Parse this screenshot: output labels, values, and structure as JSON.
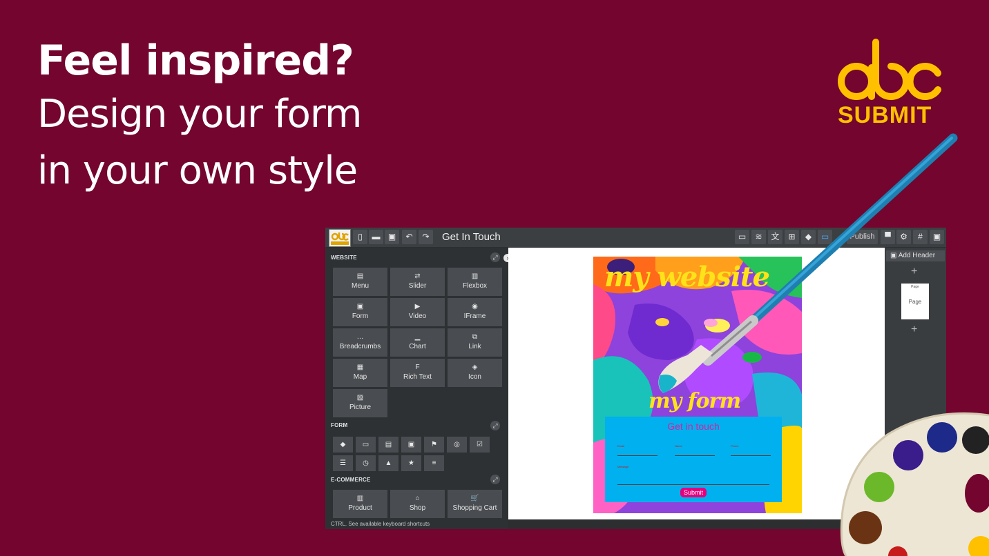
{
  "headline": {
    "line1": "Feel inspired?",
    "line2": "Design your  form",
    "line3": "in your own style"
  },
  "brand": {
    "wordmark": "SUBMIT",
    "color": "#ffc000"
  },
  "colors": {
    "background": "#73052e",
    "accent": "#ffc000",
    "form_bg": "#00b0ef",
    "submit": "#e6007e"
  },
  "editor": {
    "toolbar": {
      "logo_text": "SUBMIT",
      "title": "Get In Touch",
      "publish_label": "Publish",
      "left_icons": [
        "new-page-icon",
        "folder-icon",
        "save-icon",
        "undo-icon",
        "redo-icon"
      ],
      "right_icons": [
        "desktop-icon",
        "database-icon",
        "translate-icon",
        "cart-icon",
        "fill-icon",
        "monitor-icon",
        "paint-roller-icon",
        "gear-icon",
        "grid-icon",
        "user-icon"
      ]
    },
    "sidebar": {
      "sections": {
        "website": "WEBSITE",
        "form": "FORM",
        "ecommerce": "E-COMMERCE"
      },
      "website_items": [
        {
          "label": "Menu",
          "icon": "menu-icon",
          "glyph": "▤"
        },
        {
          "label": "Slider",
          "icon": "slider-icon",
          "glyph": "⇄"
        },
        {
          "label": "Flexbox",
          "icon": "flexbox-icon",
          "glyph": "▥"
        },
        {
          "label": "Form",
          "icon": "form-icon",
          "glyph": "▣"
        },
        {
          "label": "Video",
          "icon": "video-icon",
          "glyph": "▶"
        },
        {
          "label": "IFrame",
          "icon": "iframe-icon",
          "glyph": "◉"
        },
        {
          "label": "Breadcrumbs",
          "icon": "breadcrumbs-icon",
          "glyph": "…"
        },
        {
          "label": "Chart",
          "icon": "chart-icon",
          "glyph": "▁"
        },
        {
          "label": "Link",
          "icon": "link-icon",
          "glyph": "⧉"
        },
        {
          "label": "Map",
          "icon": "map-icon",
          "glyph": "▦"
        },
        {
          "label": "Rich Text",
          "icon": "rich-text-icon",
          "glyph": "F"
        },
        {
          "label": "Icon",
          "icon": "icon-icon",
          "glyph": "◈"
        },
        {
          "label": "Picture",
          "icon": "picture-icon",
          "glyph": "▨"
        }
      ],
      "form_items": [
        {
          "icon": "tag-icon",
          "glyph": "◆"
        },
        {
          "icon": "text-field-icon",
          "glyph": "▭"
        },
        {
          "icon": "number-field-icon",
          "glyph": "▤"
        },
        {
          "icon": "image-field-icon",
          "glyph": "▣"
        },
        {
          "icon": "flag-icon",
          "glyph": "⚑"
        },
        {
          "icon": "radio-icon",
          "glyph": "◎"
        },
        {
          "icon": "checkbox-icon",
          "glyph": "☑"
        },
        {
          "icon": "list-icon",
          "glyph": "☰"
        },
        {
          "icon": "timer-icon",
          "glyph": "◷"
        },
        {
          "icon": "upload-icon",
          "glyph": "▲"
        },
        {
          "icon": "star-icon",
          "glyph": "★"
        },
        {
          "icon": "sliders-icon",
          "glyph": "≡"
        }
      ],
      "ecommerce_items": [
        {
          "label": "Product",
          "icon": "product-icon",
          "glyph": "▥"
        },
        {
          "label": "Shop",
          "icon": "shop-icon",
          "glyph": "⌂"
        },
        {
          "label": "Shopping Cart",
          "icon": "shopping-cart-icon",
          "glyph": "🛒"
        }
      ],
      "status": "CTRL. See available keyboard shortcuts"
    },
    "canvas": {
      "title": "my website",
      "subtitle": "my form",
      "form": {
        "heading": "Get in touch",
        "fields": [
          "Email",
          "Name",
          "Phone"
        ],
        "message_label": "Message",
        "submit_label": "Submit"
      }
    },
    "right_panel": {
      "add_header_label": "Add Header",
      "page_thumb_title": "Page",
      "page_thumb_label": "Page"
    }
  }
}
